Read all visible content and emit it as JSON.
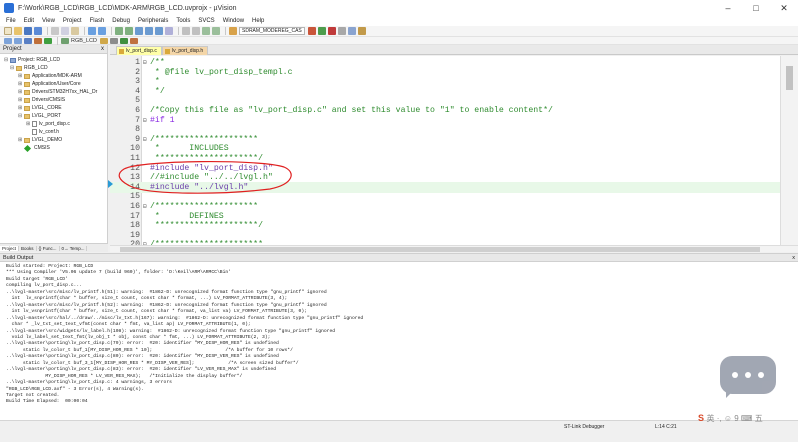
{
  "window": {
    "title": "F:\\Work\\RGB_LCD\\RGB_LCD\\MDK-ARM\\RGB_LCD.uvprojx - µVision",
    "minimize": "–",
    "maximize": "□",
    "close": "✕"
  },
  "menu": [
    "File",
    "Edit",
    "View",
    "Project",
    "Flash",
    "Debug",
    "Peripherals",
    "Tools",
    "SVCS",
    "Window",
    "Help"
  ],
  "toolbar": {
    "target_combo": "SDRAM_MODEREG_CAS",
    "build_target": "RGB_LCD"
  },
  "project_panel": {
    "title": "Project",
    "close": "x",
    "items": [
      {
        "label": "Project: RGB_LCD",
        "icon": "project-icon"
      },
      {
        "label": "RGB_LCD",
        "icon": "folder-icon"
      },
      {
        "label": "Application/MDK-ARM",
        "icon": "folder-icon"
      },
      {
        "label": "Application/User/Core",
        "icon": "folder-icon"
      },
      {
        "label": "Drivers/STM32H7xx_HAL_Dr",
        "icon": "folder-icon"
      },
      {
        "label": "Drivers/CMSIS",
        "icon": "folder-icon"
      },
      {
        "label": "LVGL_CORE",
        "icon": "folder-icon"
      },
      {
        "label": "LVGL_PORT",
        "icon": "folder-icon"
      },
      {
        "label": "lv_port_disp.c",
        "icon": "file-icon"
      },
      {
        "label": "lv_conf.h",
        "icon": "file-icon"
      },
      {
        "label": "LVGL_DEMO",
        "icon": "folder-icon"
      },
      {
        "label": "CMSIS",
        "icon": "diamond-icon"
      }
    ],
    "tabs": [
      "Project",
      "Books",
      "{} Func...",
      "0→ Temp..."
    ]
  },
  "editor": {
    "tabs": [
      {
        "label": "lv_port_disp.c",
        "active": true
      },
      {
        "label": "lv_port_disp.h",
        "active": false
      }
    ],
    "lines": [
      {
        "n": "1",
        "text": "/**",
        "fold": "⊟",
        "cls": "c-cm"
      },
      {
        "n": "2",
        "text": " * @file lv_port_disp_templ.c",
        "fold": "",
        "cls": "c-cm"
      },
      {
        "n": "3",
        "text": " *",
        "fold": "",
        "cls": "c-cm"
      },
      {
        "n": "4",
        "text": " */",
        "fold": "",
        "cls": "c-cm"
      },
      {
        "n": "5",
        "text": "",
        "fold": "",
        "cls": ""
      },
      {
        "n": "6",
        "text": "/*Copy this file as \"lv_port_disp.c\" and set this value to \"1\" to enable content*/",
        "fold": "",
        "cls": "c-cm"
      },
      {
        "n": "7",
        "text": "#if 1",
        "fold": "⊟",
        "cls": "c-pp"
      },
      {
        "n": "8",
        "text": "",
        "fold": "",
        "cls": ""
      },
      {
        "n": "9",
        "text": "/*********************",
        "fold": "⊟",
        "cls": "c-cm"
      },
      {
        "n": "10",
        "text": " *      INCLUDES",
        "fold": "",
        "cls": "c-cm"
      },
      {
        "n": "11",
        "text": " *********************/",
        "fold": "",
        "cls": "c-cm"
      },
      {
        "n": "12",
        "text": "#include \"lv_port_disp.h\"",
        "fold": "",
        "cls": "c-pp2"
      },
      {
        "n": "13",
        "text": "//#include \"../../lvgl.h\"",
        "fold": "",
        "cls": "c-cm"
      },
      {
        "n": "14",
        "text": "#include \"../lvgl.h\"",
        "fold": "",
        "cls": "c-pp2"
      },
      {
        "n": "15",
        "text": "",
        "fold": "",
        "cls": ""
      },
      {
        "n": "16",
        "text": "/*********************",
        "fold": "⊟",
        "cls": "c-cm"
      },
      {
        "n": "17",
        "text": " *      DEFINES",
        "fold": "",
        "cls": "c-cm"
      },
      {
        "n": "18",
        "text": " *********************/",
        "fold": "",
        "cls": "c-cm"
      },
      {
        "n": "19",
        "text": "",
        "fold": "",
        "cls": ""
      },
      {
        "n": "20",
        "text": "/**********************",
        "fold": "⊟",
        "cls": "c-cm"
      }
    ]
  },
  "build_output": {
    "title": "Build Output",
    "close": "x",
    "lines": [
      "Build started: Project: RGB_LCD",
      "*** Using Compiler 'V5.06 update 7 (build 960)', folder: 'D:\\Keil\\ARM\\ARMCC\\Bin'",
      "Build target 'RGB_LCD'",
      "compiling lv_port_disp.c...",
      "..\\lvgl-master\\src/misc/lv_printf.h(51): warning:  #1862-D: unrecognized format function type \"gnu_printf\" ignored",
      "  int  lv_snprintf(char * buffer, size_t count, const char * format, ...) LV_FORMAT_ATTRIBUTE(3, 4);",
      "..\\lvgl-master\\src/misc/lv_printf.h(52): warning:  #1862-D: unrecognized format function type \"gnu_printf\" ignored",
      "  int lv_vsnprintf(char * buffer, size_t count, const char * format, va_list va) LV_FORMAT_ATTRIBUTE(3, 0);",
      "..\\lvgl-master\\src/hal/../draw/../misc/lv_txt.h(167): warning:  #1862-D: unrecognized format function type \"gnu_printf\" ignored",
      "  char * _lv_txt_set_text_vfmt(const char * fmt, va_list ap) LV_FORMAT_ATTRIBUTE(1, 0);",
      "..\\lvgl-master\\src/widgets/lv_label.h(108): warning:  #1862-D: unrecognized format function type \"gnu_printf\" ignored",
      "  void lv_label_set_text_fmt(lv_obj_t * obj, const char * fmt, ...) LV_FORMAT_ATTRIBUTE(2, 3);",
      "..\\lvgl-master\\porting\\lv_port_disp.c(79): error:  #20: identifier \"MY_DISP_HOR_RES\" is undefined",
      "      static lv_color_t buf_1[MY_DISP_HOR_RES * 10];                          /*A buffer for 10 rows*/",
      "..\\lvgl-master\\porting\\lv_port_disp.c(80): error:  #20: identifier \"MY_DISP_VER_RES\" is undefined",
      "      static lv_color_t buf_3_1[MY_DISP_HOR_RES * MY_DISP_VER_RES];            /*A screen sized buffer*/",
      "..\\lvgl-master\\porting\\lv_port_disp.c(83): error:  #20: identifier \"LV_VER_RES_MAX\" is undefined",
      "              MY_DISP_HOR_RES * LV_VER_RES_MAX);   /*Initialize the display buffer*/",
      "..\\lvgl-master\\porting\\lv_port_disp.c: 4 warnings, 3 errors",
      "\"RGB_LCD\\RGB_LCD.axf\" - 3 Error(s), 4 Warning(s).",
      "Target not created.",
      "Build Time Elapsed:  00:00:04"
    ]
  },
  "status_bar": {
    "debugger": "ST-Link Debugger",
    "cursor": "L:14 C:21"
  },
  "watermark": {
    "logo": "S",
    "text": "英 ·, ☺ 9 ⌨ 五"
  },
  "colors": {
    "annotation": "#e02020",
    "active_tab": "#ffffa8",
    "inactive_tab": "#f4d6a8",
    "comment": "#2e8b2e"
  }
}
